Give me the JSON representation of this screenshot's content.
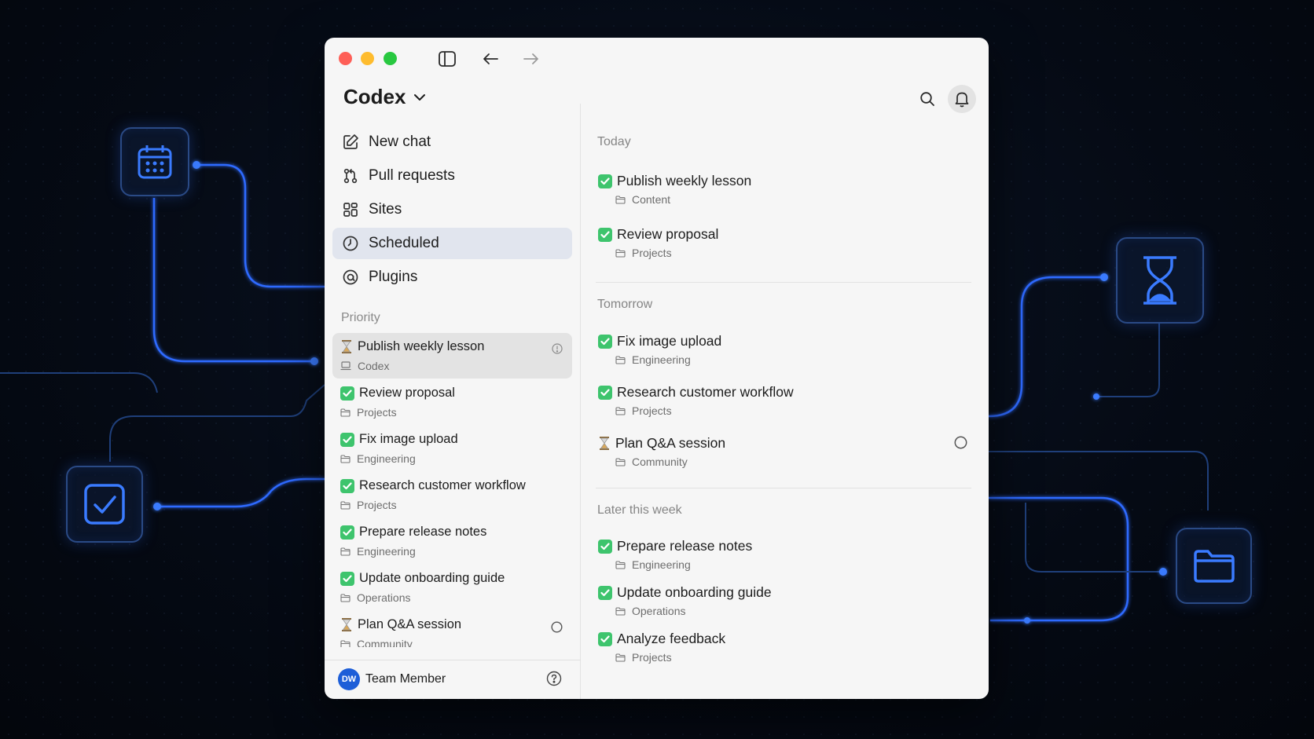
{
  "app": {
    "title": "Codex"
  },
  "colors": {
    "accent": "#1d5ed8",
    "check_green": "#3ec46d",
    "active_nav_bg": "#e1e5ee",
    "glow_blue": "#2f6bff"
  },
  "titlebar": {
    "icons": [
      "sidebar-toggle-icon",
      "back-arrow-icon",
      "forward-arrow-icon"
    ]
  },
  "nav": [
    {
      "label": "New chat",
      "icon": "compose-icon"
    },
    {
      "label": "Pull requests",
      "icon": "pull-request-icon"
    },
    {
      "label": "Sites",
      "icon": "grid-icon"
    },
    {
      "label": "Scheduled",
      "icon": "clock-icon",
      "active": true
    },
    {
      "label": "Plugins",
      "icon": "plugin-icon"
    }
  ],
  "priority": {
    "label": "Priority",
    "items": [
      {
        "title": "Publish weekly lesson",
        "sub": "Codex",
        "status": "hourglass",
        "selected": true
      },
      {
        "title": "Review proposal",
        "sub": "Projects",
        "status": "check"
      },
      {
        "title": "Fix image upload",
        "sub": "Engineering",
        "status": "check"
      },
      {
        "title": "Research customer workflow",
        "sub": "Projects",
        "status": "check"
      },
      {
        "title": "Prepare release notes",
        "sub": "Engineering",
        "status": "check"
      },
      {
        "title": "Update onboarding guide",
        "sub": "Operations",
        "status": "check"
      },
      {
        "title": "Plan Q&A session",
        "sub": "Community",
        "status": "hourglass"
      }
    ]
  },
  "footer": {
    "avatar_initials": "DW",
    "user_name": "Team Member"
  },
  "main": {
    "groups": [
      {
        "label": "Today",
        "items": [
          {
            "title": "Publish weekly lesson",
            "sub": "Content",
            "status": "check"
          },
          {
            "title": "Review proposal",
            "sub": "Projects",
            "status": "check"
          }
        ]
      },
      {
        "label": "Tomorrow",
        "items": [
          {
            "title": "Fix image upload",
            "sub": "Engineering",
            "status": "check"
          },
          {
            "title": "Research customer workflow",
            "sub": "Projects",
            "status": "check"
          },
          {
            "title": "Plan Q&A session",
            "sub": "Community",
            "status": "hourglass"
          }
        ]
      },
      {
        "label": "Later this week",
        "items": [
          {
            "title": "Prepare release notes",
            "sub": "Engineering",
            "status": "check"
          },
          {
            "title": "Update onboarding guide",
            "sub": "Operations",
            "status": "check"
          },
          {
            "title": "Analyze feedback",
            "sub": "Projects",
            "status": "check"
          }
        ]
      }
    ]
  }
}
